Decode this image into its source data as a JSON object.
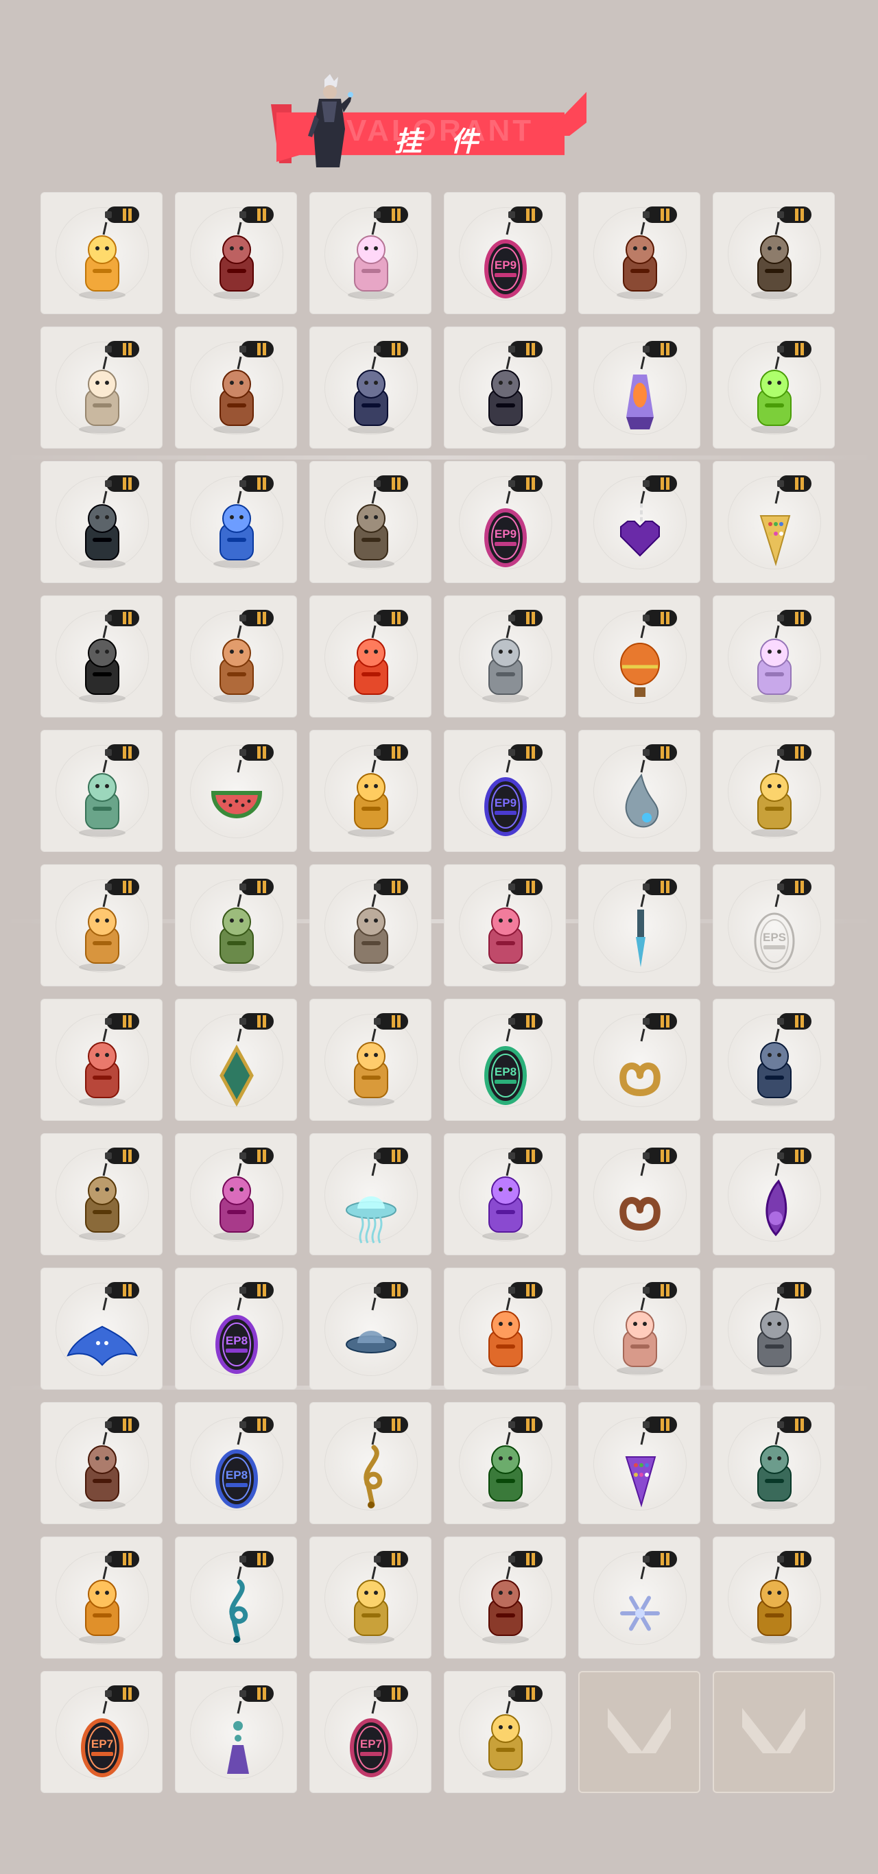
{
  "header": {
    "title": "挂 件",
    "watermark": "VALORANT"
  },
  "colors": {
    "page_bg": "#cbc3bf",
    "accent": "#ff4657",
    "card_bg": "#ece9e5",
    "empty_card_bg": "#cfc5bc"
  },
  "grid": {
    "columns": 6,
    "rows": 12,
    "cells": [
      {
        "name": "treasure-chest-duck-charm",
        "icon": "duck-in-tub",
        "color": "#f2a83a",
        "label": ""
      },
      {
        "name": "paracord-braid-charm",
        "icon": "braided-cord",
        "color": "#8b2f2f",
        "label": ""
      },
      {
        "name": "cupcake-charm",
        "icon": "cupcake",
        "color": "#e7a6c6",
        "label": ""
      },
      {
        "name": "ep9-act-badge-charm",
        "icon": "oval-badge",
        "color": "#c8367a",
        "label": "EP9"
      },
      {
        "name": "bear-with-bell-charm",
        "icon": "bear",
        "color": "#8a4a34",
        "label": ""
      },
      {
        "name": "retro-camera-charm",
        "icon": "camera",
        "color": "#5b4a39",
        "label": ""
      },
      {
        "name": "cowboy-agent-figure-charm",
        "icon": "figure",
        "color": "#c9b8a0",
        "label": ""
      },
      {
        "name": "leather-bag-charm",
        "icon": "bag",
        "color": "#9a5534",
        "label": ""
      },
      {
        "name": "owl-drone-tassel-charm",
        "icon": "owl",
        "color": "#3a3f63",
        "label": ""
      },
      {
        "name": "wolf-head-charm",
        "icon": "wolf",
        "color": "#3a3845",
        "label": ""
      },
      {
        "name": "lava-lamp-charm",
        "icon": "lamp",
        "color": "#8c6be0",
        "label": ""
      },
      {
        "name": "green-pager-charm",
        "icon": "pager",
        "color": "#7ccf3a",
        "label": ""
      },
      {
        "name": "sneaker-charm",
        "icon": "shoe",
        "color": "#2a3238",
        "label": ""
      },
      {
        "name": "astronaut-robot-charm",
        "icon": "astronaut",
        "color": "#3b6bd1",
        "label": ""
      },
      {
        "name": "gadget-device-charm",
        "icon": "device",
        "color": "#6b5c4a",
        "label": ""
      },
      {
        "name": "ep9-act-badge-2-charm",
        "icon": "oval-badge",
        "color": "#c23a86",
        "label": "EP9"
      },
      {
        "name": "pixel-heart-charm",
        "icon": "heart",
        "color": "#6a2aa8",
        "label": ""
      },
      {
        "name": "melon-slice-charm",
        "icon": "slice",
        "color": "#e9c15a",
        "label": ""
      },
      {
        "name": "feather-star-charm",
        "icon": "feather",
        "color": "#2b2b2b",
        "label": ""
      },
      {
        "name": "popsicle-charm",
        "icon": "popsicle",
        "color": "#b06a3a",
        "label": ""
      },
      {
        "name": "fire-lantern-charm",
        "icon": "lantern",
        "color": "#e5492a",
        "label": ""
      },
      {
        "name": "agent-card-charm",
        "icon": "card",
        "color": "#8a9096",
        "label": ""
      },
      {
        "name": "hot-air-balloon-charm",
        "icon": "balloon",
        "color": "#e8792e",
        "label": ""
      },
      {
        "name": "anime-girl-charm",
        "icon": "girl",
        "color": "#c8a8ea",
        "label": ""
      },
      {
        "name": "robot-totem-charm",
        "icon": "robot",
        "color": "#6aa58a",
        "label": ""
      },
      {
        "name": "watermelon-charm",
        "icon": "watermelon",
        "color": "#e35a5a",
        "label": ""
      },
      {
        "name": "beehive-honey-charm",
        "icon": "beehive",
        "color": "#d99a2e",
        "label": ""
      },
      {
        "name": "ep9-act-badge-3-charm",
        "icon": "oval-badge",
        "color": "#4a3bd1",
        "label": "EP9"
      },
      {
        "name": "water-drop-charm",
        "icon": "drop",
        "color": "#8aa0ad",
        "label": ""
      },
      {
        "name": "golden-mech-charm",
        "icon": "mech",
        "color": "#c9a13a",
        "label": ""
      },
      {
        "name": "squirrel-charm",
        "icon": "squirrel",
        "color": "#d8953e",
        "label": ""
      },
      {
        "name": "plant-monster-charm",
        "icon": "plant",
        "color": "#6a8a4a",
        "label": ""
      },
      {
        "name": "raccoon-charm",
        "icon": "raccoon",
        "color": "#8a7a6a",
        "label": ""
      },
      {
        "name": "hero-robot-charm",
        "icon": "hero",
        "color": "#c04a6a",
        "label": ""
      },
      {
        "name": "blue-dagger-charm",
        "icon": "dagger",
        "color": "#4fb6d8",
        "label": ""
      },
      {
        "name": "eps-outline-charm",
        "icon": "outline-badge",
        "color": "#bdbab6",
        "label": "EPS"
      },
      {
        "name": "octopus-charm",
        "icon": "octopus",
        "color": "#b8473a",
        "label": ""
      },
      {
        "name": "green-diamond-charm",
        "icon": "diamond",
        "color": "#2e7a62",
        "label": ""
      },
      {
        "name": "sun-cloud-charm",
        "icon": "sun",
        "color": "#d99a3a",
        "label": ""
      },
      {
        "name": "ep8-act-badge-charm",
        "icon": "oval-badge",
        "color": "#2bb07a",
        "label": "EP8"
      },
      {
        "name": "golden-pretzel-charm",
        "icon": "pretzel",
        "color": "#c9973a",
        "label": ""
      },
      {
        "name": "penguin-claw-charm",
        "icon": "penguin",
        "color": "#3a4b6a",
        "label": ""
      },
      {
        "name": "bottle-charm",
        "icon": "bottle",
        "color": "#8a6a3a",
        "label": ""
      },
      {
        "name": "jetski-charm",
        "icon": "jetski",
        "color": "#a83a8a",
        "label": ""
      },
      {
        "name": "jellyfish-ufo-charm",
        "icon": "jellyfish",
        "color": "#8ad8e0",
        "label": ""
      },
      {
        "name": "purple-flame-lotus-charm",
        "icon": "lotus",
        "color": "#8a4ad0",
        "label": ""
      },
      {
        "name": "pretzel-charm",
        "icon": "pretzel",
        "color": "#8a4a2a",
        "label": ""
      },
      {
        "name": "purple-crystal-charm",
        "icon": "crystal",
        "color": "#7a3ab0",
        "label": ""
      },
      {
        "name": "manta-ray-charm",
        "icon": "manta",
        "color": "#3a6ad8",
        "label": ""
      },
      {
        "name": "ep8-act-badge-2-charm",
        "icon": "oval-badge",
        "color": "#8a3ad0",
        "label": "EP8"
      },
      {
        "name": "ufo-saucer-charm",
        "icon": "ufo",
        "color": "#4a6a8a",
        "label": ""
      },
      {
        "name": "fire-lizard-charm",
        "icon": "lizard",
        "color": "#e06a2a",
        "label": ""
      },
      {
        "name": "koi-fish-charm",
        "icon": "fish",
        "color": "#d89a8a",
        "label": ""
      },
      {
        "name": "gray-cat-pouch-charm",
        "icon": "cat",
        "color": "#6a6e75",
        "label": ""
      },
      {
        "name": "speaker-box-charm",
        "icon": "speaker",
        "color": "#7a4a3a",
        "label": ""
      },
      {
        "name": "ep8-act-badge-3-charm",
        "icon": "oval-badge",
        "color": "#3a5ad0",
        "label": "EP8"
      },
      {
        "name": "treble-clef-gold-charm",
        "icon": "clef",
        "color": "#b88a2a",
        "label": ""
      },
      {
        "name": "campfire-lantern-charm",
        "icon": "firebox",
        "color": "#3a7a3a",
        "label": ""
      },
      {
        "name": "sprinkle-slice-charm",
        "icon": "slice",
        "color": "#8a4ad0",
        "label": ""
      },
      {
        "name": "goggles-pendant-charm",
        "icon": "goggles",
        "color": "#3a6a5a",
        "label": ""
      },
      {
        "name": "orange-bird-charm",
        "icon": "bird",
        "color": "#e0902a",
        "label": ""
      },
      {
        "name": "treble-clef-teal-charm",
        "icon": "clef",
        "color": "#2a8a9a",
        "label": ""
      },
      {
        "name": "golden-lamp-charm",
        "icon": "lamp-gold",
        "color": "#c9a13a",
        "label": ""
      },
      {
        "name": "pot-bucket-charm",
        "icon": "pot",
        "color": "#8a3a2a",
        "label": ""
      },
      {
        "name": "snowflake-charm",
        "icon": "snowflake",
        "color": "#9aa8e0",
        "label": ""
      },
      {
        "name": "golden-idol-charm",
        "icon": "idol",
        "color": "#b8801a",
        "label": ""
      },
      {
        "name": "ep7-act-badge-charm",
        "icon": "oval-badge",
        "color": "#e0602a",
        "label": "EP7"
      },
      {
        "name": "purple-tassel-charm",
        "icon": "tassel",
        "color": "#6a4ab0",
        "label": ""
      },
      {
        "name": "ep7-act-badge-2-charm",
        "icon": "oval-badge",
        "color": "#c03a6a",
        "label": "EP7"
      },
      {
        "name": "valorant-gold-badge-charm",
        "icon": "v-badge",
        "color": "#c9a13a",
        "label": ""
      },
      {
        "name": "empty-slot-1",
        "icon": "valorant-logo",
        "color": "#e3dbd3",
        "label": "",
        "empty": true
      },
      {
        "name": "empty-slot-2",
        "icon": "valorant-logo",
        "color": "#e3dbd3",
        "label": "",
        "empty": true
      }
    ]
  }
}
